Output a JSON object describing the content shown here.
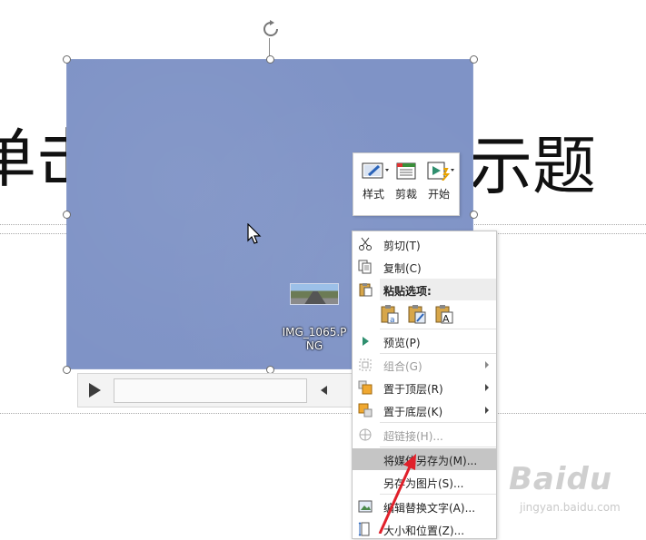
{
  "slide": {
    "title_left": "单击",
    "title_right": "示题"
  },
  "video": {
    "file_name_line1": "IMG_1065.P",
    "file_name_line2": "NG"
  },
  "mini_toolbar": {
    "buttons": [
      {
        "label": "样式",
        "icon": "video-style-icon"
      },
      {
        "label": "剪裁",
        "icon": "trim-video-icon"
      },
      {
        "label": "开始",
        "icon": "playback-start-icon"
      }
    ]
  },
  "context_menu": {
    "items": [
      {
        "label": "剪切(T)",
        "icon": "scissors-icon",
        "enabled": true
      },
      {
        "label": "复制(C)",
        "icon": "copy-icon",
        "enabled": true
      },
      {
        "label": "粘贴选项:",
        "icon": "paste-icon",
        "header": true
      },
      {
        "label": "预览(P)",
        "icon": "play-icon",
        "enabled": true
      },
      {
        "label": "组合(G)",
        "icon": "group-icon",
        "enabled": false,
        "submenu": true
      },
      {
        "label": "置于顶层(R)",
        "icon": "bring-to-front-icon",
        "enabled": true,
        "submenu": true
      },
      {
        "label": "置于底层(K)",
        "icon": "send-to-back-icon",
        "enabled": true,
        "submenu": true
      },
      {
        "label": "超链接(H)...",
        "icon": "hyperlink-icon",
        "enabled": false
      },
      {
        "label": "将媒体另存为(M)...",
        "icon": "",
        "enabled": true,
        "highlighted": true
      },
      {
        "label": "另存为图片(S)...",
        "icon": "",
        "enabled": true
      },
      {
        "label": "编辑替换文字(A)...",
        "icon": "alt-text-icon",
        "enabled": true
      },
      {
        "label": "大小和位置(Z)...",
        "icon": "size-position-icon",
        "enabled": true
      }
    ],
    "paste_options": [
      "paste-keep-format-icon",
      "paste-picture-icon",
      "paste-text-only-icon"
    ]
  },
  "watermark": {
    "brand": "Baidu",
    "sub": "jingyan.baidu.com"
  },
  "colors": {
    "video_fill": "#7f93c6",
    "menu_highlight": "#c5c5c5",
    "annotation_arrow": "#e0202a"
  }
}
